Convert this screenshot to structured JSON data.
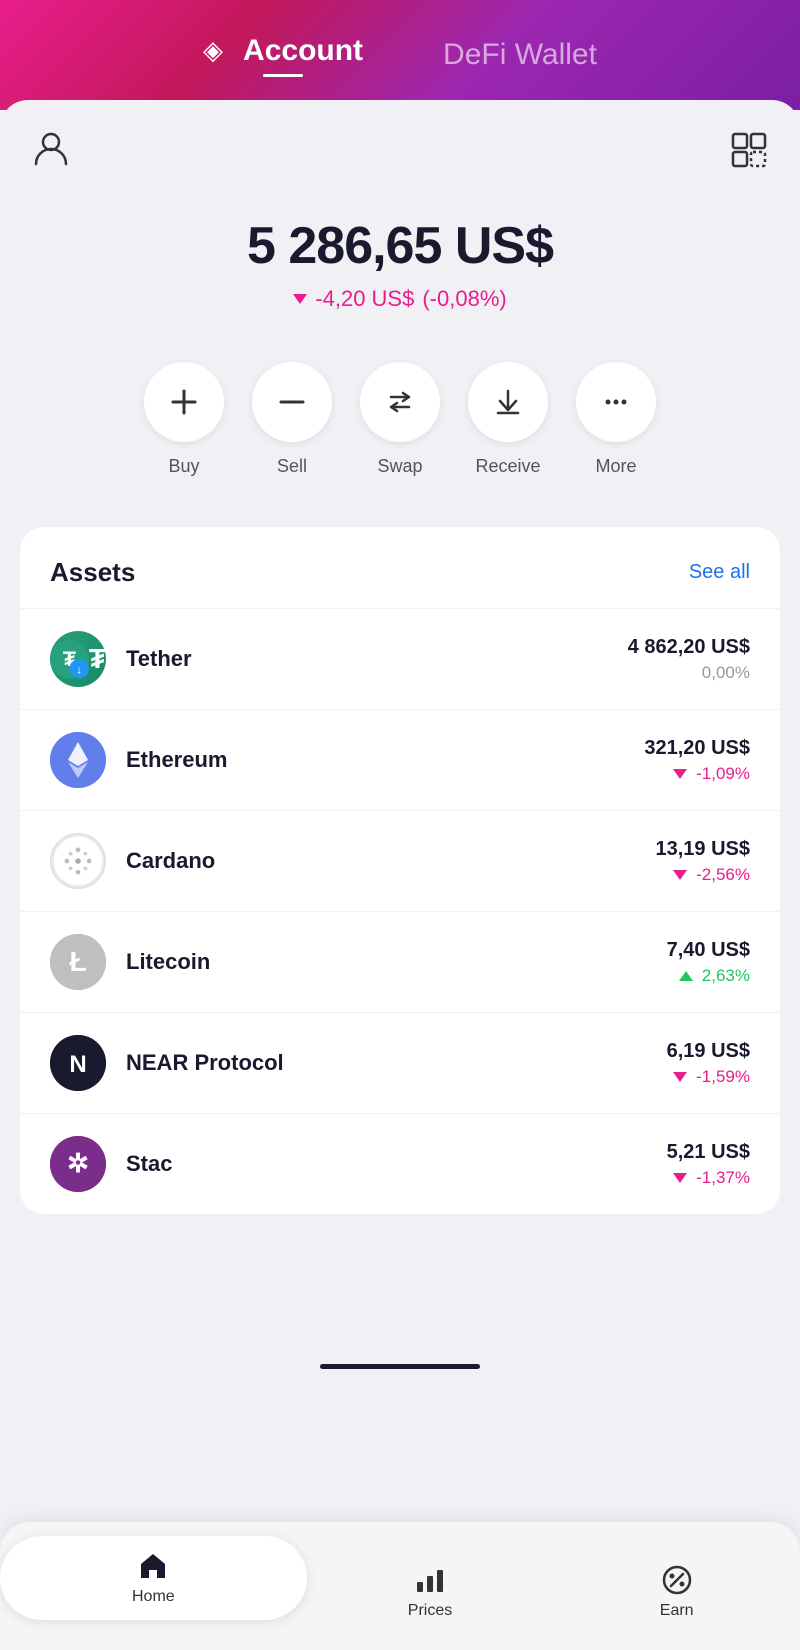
{
  "header": {
    "active_tab": "Account",
    "inactive_tab": "DeFi Wallet",
    "logo_icon": "diamond"
  },
  "balance": {
    "amount": "5 286,65 US$",
    "change_value": "-4,20 US$",
    "change_percent": "(-0,08%)",
    "change_direction": "down"
  },
  "actions": [
    {
      "id": "buy",
      "label": "Buy",
      "icon": "+"
    },
    {
      "id": "sell",
      "label": "Sell",
      "icon": "−"
    },
    {
      "id": "swap",
      "label": "Swap",
      "icon": "⇄"
    },
    {
      "id": "receive",
      "label": "Receive",
      "icon": "↓"
    },
    {
      "id": "more",
      "label": "More",
      "icon": "···"
    }
  ],
  "assets": {
    "section_title": "Assets",
    "see_all_label": "See all",
    "items": [
      {
        "id": "tether",
        "name": "Tether",
        "amount": "4 862,20 US$",
        "change": "0,00%",
        "change_direction": "neutral",
        "icon_symbol": "₮",
        "icon_type": "tether"
      },
      {
        "id": "ethereum",
        "name": "Ethereum",
        "amount": "321,20 US$",
        "change": "-1,09%",
        "change_direction": "negative",
        "icon_symbol": "♦",
        "icon_type": "eth"
      },
      {
        "id": "cardano",
        "name": "Cardano",
        "amount": "13,19 US$",
        "change": "-2,56%",
        "change_direction": "negative",
        "icon_symbol": "✦",
        "icon_type": "ada"
      },
      {
        "id": "litecoin",
        "name": "Litecoin",
        "amount": "7,40 US$",
        "change": "2,63%",
        "change_direction": "positive",
        "icon_symbol": "Ł",
        "icon_type": "ltc"
      },
      {
        "id": "near",
        "name": "NEAR Protocol",
        "amount": "6,19 US$",
        "change": "-1,59%",
        "change_direction": "negative",
        "icon_symbol": "Ν",
        "icon_type": "near"
      },
      {
        "id": "stacks",
        "name": "Stac",
        "amount": "5,21 US$",
        "change": "-1,37%",
        "change_direction": "negative",
        "icon_symbol": "⚹",
        "icon_type": "stx"
      }
    ]
  },
  "bottom_nav": {
    "items": [
      {
        "id": "home",
        "label": "Home",
        "icon": "home",
        "active": true
      },
      {
        "id": "prices",
        "label": "Prices",
        "icon": "chart",
        "active": false
      },
      {
        "id": "earn",
        "label": "Earn",
        "icon": "percent",
        "active": false
      }
    ]
  }
}
